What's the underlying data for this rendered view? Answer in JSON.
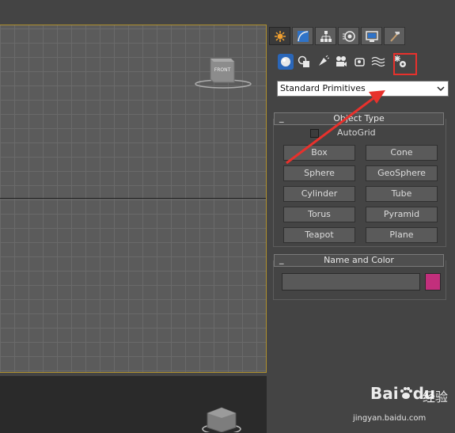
{
  "viewport": {
    "viewcube_label": "FRONT"
  },
  "command_panel": {
    "tabs": [
      {
        "name": "create-tab",
        "icon": "create-icon",
        "active": true
      },
      {
        "name": "modify-tab",
        "icon": "modify-icon",
        "active": false
      },
      {
        "name": "hierarchy-tab",
        "icon": "hierarchy-icon",
        "active": false
      },
      {
        "name": "motion-tab",
        "icon": "motion-icon",
        "active": false
      },
      {
        "name": "display-tab",
        "icon": "display-icon",
        "active": false
      },
      {
        "name": "utilities-tab",
        "icon": "utilities-icon",
        "active": false
      }
    ],
    "subtabs": [
      {
        "name": "geometry",
        "icon": "geometry-icon",
        "active": true
      },
      {
        "name": "shapes",
        "icon": "shapes-icon",
        "active": false
      },
      {
        "name": "lights",
        "icon": "lights-icon",
        "active": false
      },
      {
        "name": "cameras",
        "icon": "cameras-icon",
        "active": false
      },
      {
        "name": "helpers",
        "icon": "helpers-icon",
        "active": false
      },
      {
        "name": "space-warps",
        "icon": "space-warps-icon",
        "active": false
      },
      {
        "name": "systems",
        "icon": "systems-icon",
        "active": false
      }
    ],
    "dropdown_value": "Standard Primitives",
    "object_type": {
      "title": "Object Type",
      "toggle": "_",
      "autogrid_label": "AutoGrid",
      "buttons": [
        "Box",
        "Cone",
        "Sphere",
        "GeoSphere",
        "Cylinder",
        "Tube",
        "Torus",
        "Pyramid",
        "Teapot",
        "Plane"
      ]
    },
    "name_and_color": {
      "title": "Name and Color",
      "toggle": "_",
      "name_value": "",
      "color": "#c22f7c"
    }
  },
  "annotation": {
    "highlight_color": "#e8312c"
  },
  "watermark": {
    "brand": "Bai",
    "brand_suffix": "du",
    "cn_text": "经验",
    "url": "jingyan.baidu.com"
  }
}
